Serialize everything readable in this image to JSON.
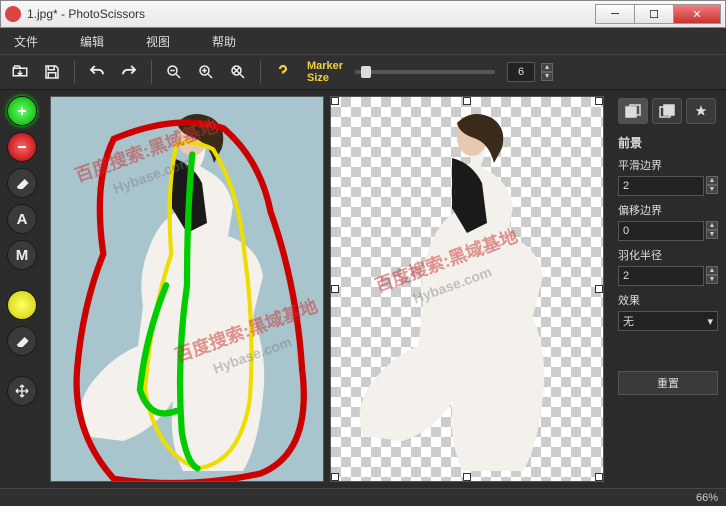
{
  "window": {
    "title": "1.jpg* - PhotoScissors"
  },
  "menubar": {
    "file": "文件",
    "edit": "编辑",
    "view": "视图",
    "help": "帮助"
  },
  "toolbar": {
    "marker_label_line1": "Marker",
    "marker_label_line2": "Size",
    "marker_value": "6"
  },
  "panel": {
    "section": "前景",
    "smooth_label": "平滑边界",
    "smooth_value": "2",
    "offset_label": "偏移边界",
    "offset_value": "0",
    "feather_label": "羽化半径",
    "feather_value": "2",
    "effect_label": "效果",
    "effect_value": "无",
    "reset": "重置"
  },
  "status": {
    "zoom": "66%"
  },
  "watermarks": {
    "text1": "百度搜索:黑域基地",
    "text2": "Hybase.com"
  },
  "colors": {
    "fg_marker": "#00cc00",
    "bg_marker": "#cc0000",
    "edge_marker": "#eedd00"
  }
}
